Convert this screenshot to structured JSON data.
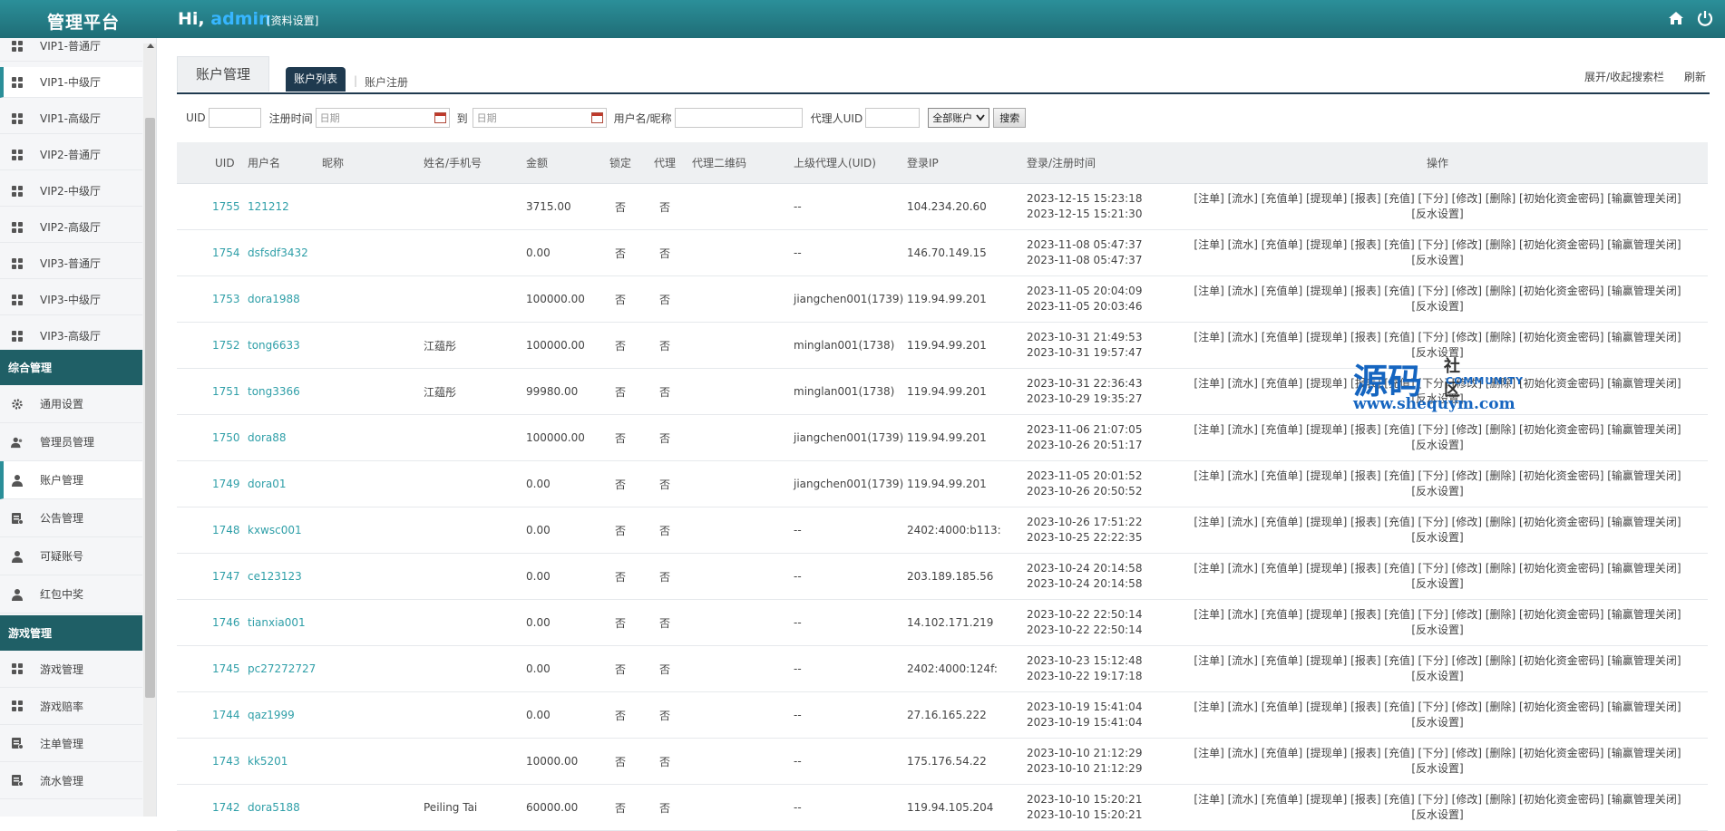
{
  "header": {
    "brand": "管理平台",
    "greeting": "Hi,",
    "username": "admin",
    "profile_link": "[资料设置]"
  },
  "sidebar": {
    "items_top": [
      {
        "label": "VIP1-普通厅"
      },
      {
        "label": "VIP1-中级厅"
      },
      {
        "label": "VIP1-高级厅"
      },
      {
        "label": "VIP2-普通厅"
      },
      {
        "label": "VIP2-中级厅"
      },
      {
        "label": "VIP2-高级厅"
      },
      {
        "label": "VIP3-普通厅"
      },
      {
        "label": "VIP3-中级厅"
      },
      {
        "label": "VIP3-高级厅"
      }
    ],
    "section1": "综合管理",
    "items_mid": [
      {
        "label": "通用设置"
      },
      {
        "label": "管理员管理"
      },
      {
        "label": "账户管理"
      },
      {
        "label": "公告管理"
      },
      {
        "label": "可疑账号"
      },
      {
        "label": "红包中奖"
      }
    ],
    "section2": "游戏管理",
    "items_bottom": [
      {
        "label": "游戏管理"
      },
      {
        "label": "游戏赔率"
      },
      {
        "label": "注单管理"
      },
      {
        "label": "流水管理"
      }
    ]
  },
  "tabs": {
    "title": "账户管理",
    "list": "账户列表",
    "sep": "|",
    "register": "账户注册",
    "toggle_search": "展开/收起搜索栏",
    "refresh": "刷新"
  },
  "search": {
    "uid_label": "UID",
    "regtime_label": "注册时间",
    "date_placeholder": "日期",
    "to_label": "到",
    "username_label": "用户名/昵称",
    "agent_uid_label": "代理人UID",
    "account_select": "全部账户",
    "search_button": "搜索"
  },
  "table": {
    "headers": [
      "UID",
      "用户名",
      "昵称",
      "姓名/手机号",
      "金额",
      "锁定",
      "代理",
      "代理二维码",
      "上级代理人(UID)",
      "登录IP",
      "登录/注册时间",
      "操作"
    ],
    "ops_line1": "[注单] [流水] [充值单] [提现单] [报表] [充值] [下分] [修改] [删除] [初始化资金密码] [输赢管理关闭]",
    "ops_line2": "[反水设置]",
    "rows": [
      {
        "uid": "1755",
        "username": "121212",
        "nickname": "",
        "name": "",
        "amount": "3715.00",
        "locked": "否",
        "agent": "否",
        "qr": "",
        "parent": "--",
        "ip": "104.234.20.60",
        "login": "2023-12-15 15:23:18",
        "reg": "2023-12-15 15:21:30"
      },
      {
        "uid": "1754",
        "username": "dsfsdf3432",
        "nickname": "",
        "name": "",
        "amount": "0.00",
        "locked": "否",
        "agent": "否",
        "qr": "",
        "parent": "--",
        "ip": "146.70.149.15",
        "login": "2023-11-08 05:47:37",
        "reg": "2023-11-08 05:47:37"
      },
      {
        "uid": "1753",
        "username": "dora1988",
        "nickname": "",
        "name": "",
        "amount": "100000.00",
        "locked": "否",
        "agent": "否",
        "qr": "",
        "parent": "jiangchen001(1739)",
        "ip": "119.94.99.201",
        "login": "2023-11-05 20:04:09",
        "reg": "2023-11-05 20:03:46"
      },
      {
        "uid": "1752",
        "username": "tong6633",
        "nickname": "",
        "name": "江蕴彤",
        "amount": "100000.00",
        "locked": "否",
        "agent": "否",
        "qr": "",
        "parent": "minglan001(1738)",
        "ip": "119.94.99.201",
        "login": "2023-10-31 21:49:53",
        "reg": "2023-10-31 19:57:47"
      },
      {
        "uid": "1751",
        "username": "tong3366",
        "nickname": "",
        "name": "江蕴彤",
        "amount": "99980.00",
        "locked": "否",
        "agent": "否",
        "qr": "",
        "parent": "minglan001(1738)",
        "ip": "119.94.99.201",
        "login": "2023-10-31 22:36:43",
        "reg": "2023-10-29 19:35:27"
      },
      {
        "uid": "1750",
        "username": "dora88",
        "nickname": "",
        "name": "",
        "amount": "100000.00",
        "locked": "否",
        "agent": "否",
        "qr": "",
        "parent": "jiangchen001(1739)",
        "ip": "119.94.99.201",
        "login": "2023-11-06 21:07:05",
        "reg": "2023-10-26 20:51:17"
      },
      {
        "uid": "1749",
        "username": "dora01",
        "nickname": "",
        "name": "",
        "amount": "0.00",
        "locked": "否",
        "agent": "否",
        "qr": "",
        "parent": "jiangchen001(1739)",
        "ip": "119.94.99.201",
        "login": "2023-11-05 20:01:52",
        "reg": "2023-10-26 20:50:52"
      },
      {
        "uid": "1748",
        "username": "kxwsc001",
        "nickname": "",
        "name": "",
        "amount": "0.00",
        "locked": "否",
        "agent": "否",
        "qr": "",
        "parent": "--",
        "ip": "2402:4000:b113:",
        "login": "2023-10-26 17:51:22",
        "reg": "2023-10-25 22:22:35"
      },
      {
        "uid": "1747",
        "username": "ce123123",
        "nickname": "",
        "name": "",
        "amount": "0.00",
        "locked": "否",
        "agent": "否",
        "qr": "",
        "parent": "--",
        "ip": "203.189.185.56",
        "login": "2023-10-24 20:14:58",
        "reg": "2023-10-24 20:14:58"
      },
      {
        "uid": "1746",
        "username": "tianxia001",
        "nickname": "",
        "name": "",
        "amount": "0.00",
        "locked": "否",
        "agent": "否",
        "qr": "",
        "parent": "--",
        "ip": "14.102.171.219",
        "login": "2023-10-22 22:50:14",
        "reg": "2023-10-22 22:50:14"
      },
      {
        "uid": "1745",
        "username": "pc27272727",
        "nickname": "",
        "name": "",
        "amount": "0.00",
        "locked": "否",
        "agent": "否",
        "qr": "",
        "parent": "--",
        "ip": "2402:4000:124f:",
        "login": "2023-10-23 15:12:48",
        "reg": "2023-10-22 19:17:18"
      },
      {
        "uid": "1744",
        "username": "qaz1999",
        "nickname": "",
        "name": "",
        "amount": "0.00",
        "locked": "否",
        "agent": "否",
        "qr": "",
        "parent": "--",
        "ip": "27.16.165.222",
        "login": "2023-10-19 15:41:04",
        "reg": "2023-10-19 15:41:04"
      },
      {
        "uid": "1743",
        "username": "kk5201",
        "nickname": "",
        "name": "",
        "amount": "10000.00",
        "locked": "否",
        "agent": "否",
        "qr": "",
        "parent": "--",
        "ip": "175.176.54.22",
        "login": "2023-10-10 21:12:29",
        "reg": "2023-10-10 21:12:29"
      },
      {
        "uid": "1742",
        "username": "dora5188",
        "nickname": "",
        "name": "Peiling Tai",
        "amount": "60000.00",
        "locked": "否",
        "agent": "否",
        "qr": "",
        "parent": "--",
        "ip": "119.94.105.204",
        "login": "2023-10-10 15:20:21",
        "reg": "2023-10-10 15:20:21"
      }
    ]
  },
  "watermark": {
    "big": "源码",
    "small": "社区",
    "en": "COMMUNITY",
    "url": "www.shequym.com"
  },
  "colors": {
    "header_bg": "#237f89",
    "accent": "#2b8f99",
    "section_bg": "#1f5f66",
    "link": "#2f9fa8",
    "tab_active": "#1f3a4f",
    "username_highlight": "#37b6ff"
  }
}
